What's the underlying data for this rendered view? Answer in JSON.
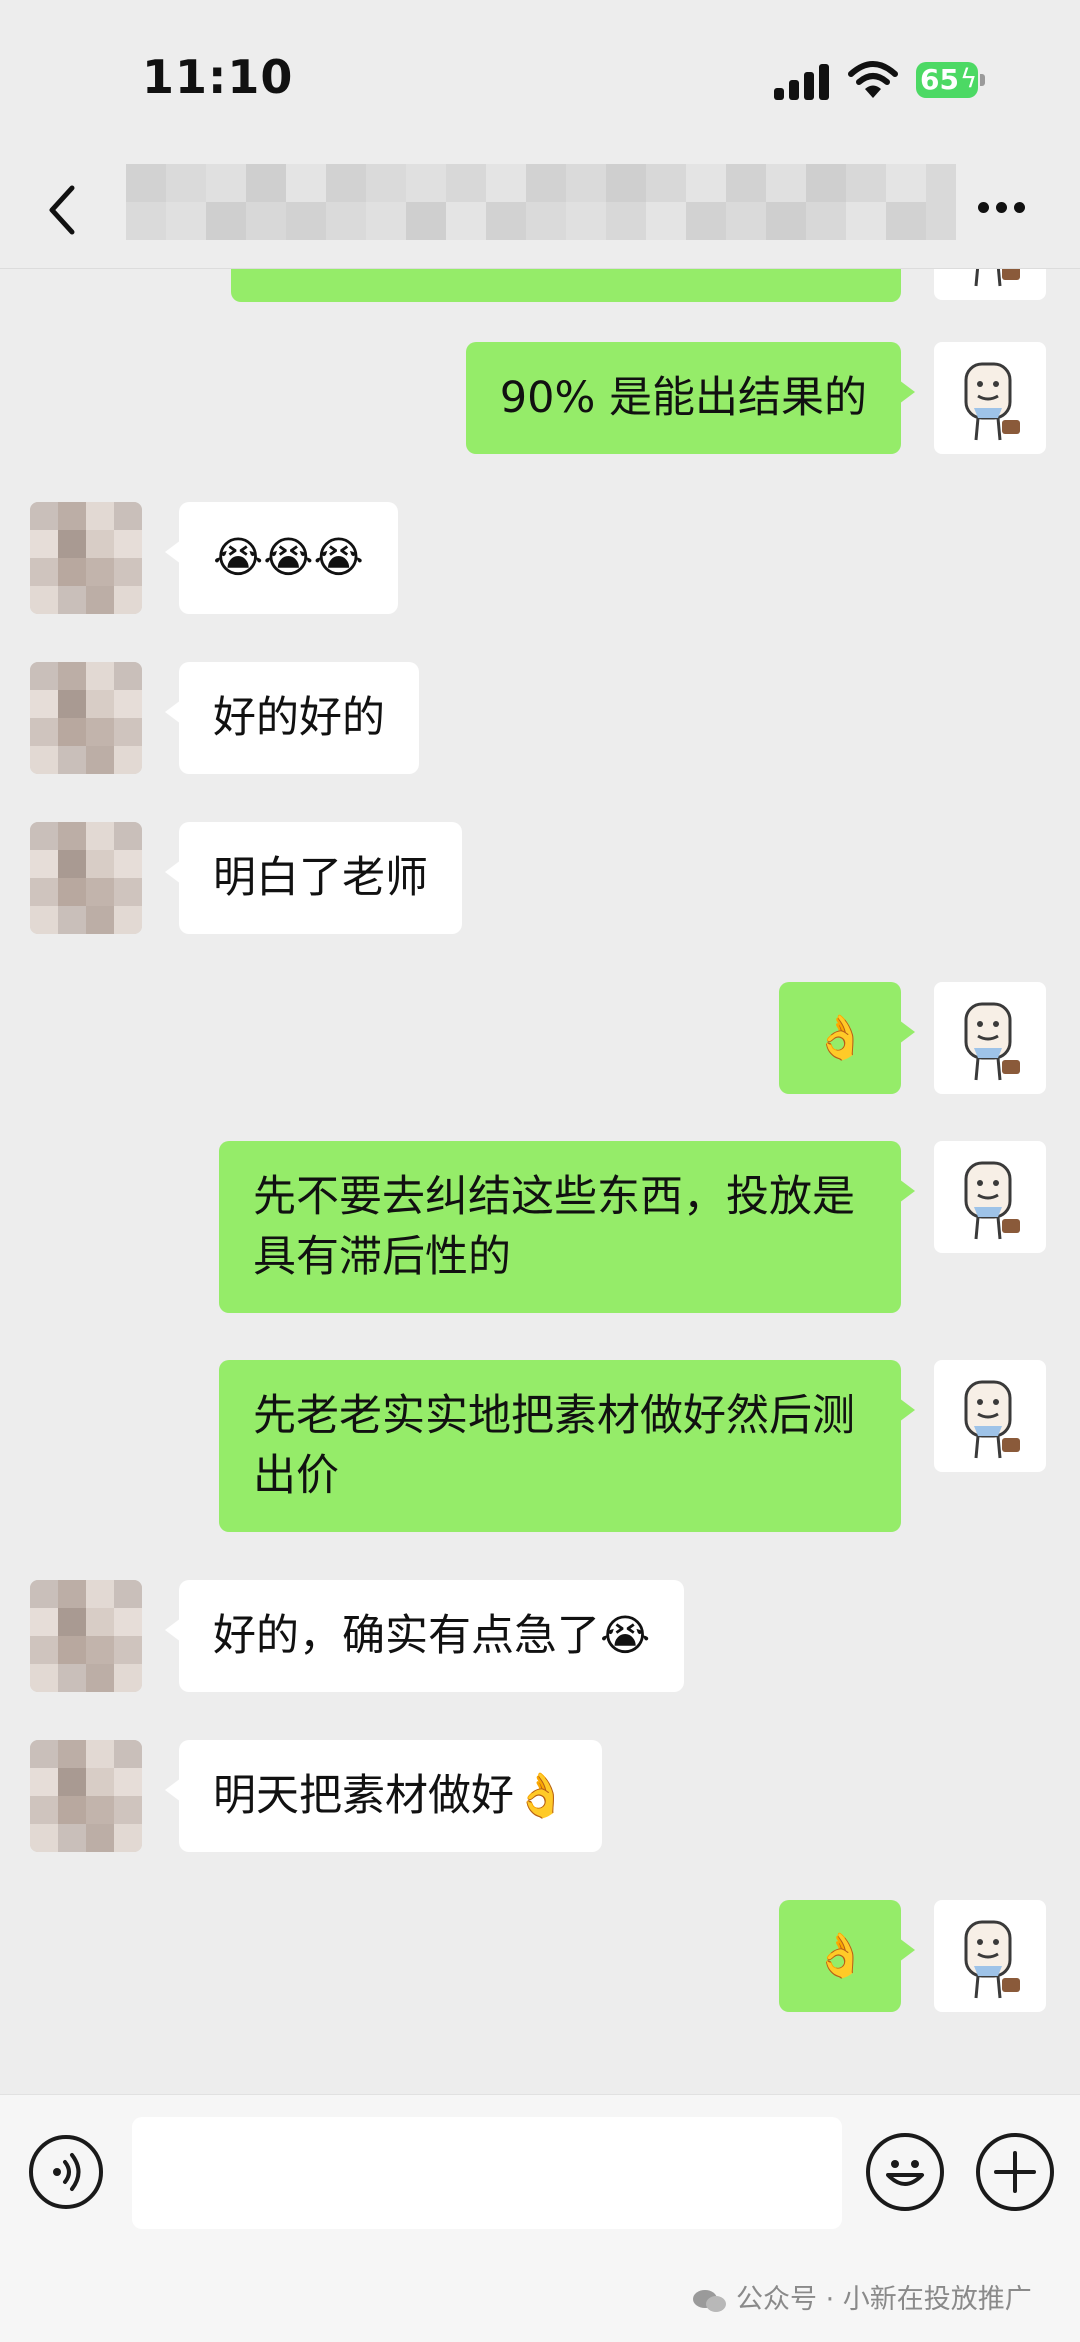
{
  "status_bar": {
    "time": "11:10",
    "battery_level": "65"
  },
  "nav": {
    "title": ""
  },
  "messages": [
    {
      "side": "self",
      "text": ""
    },
    {
      "side": "self",
      "text": "90% 是能出结果的"
    },
    {
      "side": "other",
      "text": "😭😭😭"
    },
    {
      "side": "other",
      "text": "好的好的"
    },
    {
      "side": "other",
      "text": "明白了老师"
    },
    {
      "side": "self",
      "text": "👌"
    },
    {
      "side": "self",
      "text": "先不要去纠结这些东西，投放是具有滞后性的"
    },
    {
      "side": "self",
      "text": "先老老实实地把素材做好然后测出价"
    },
    {
      "side": "other",
      "text": "好的，确实有点急了😭"
    },
    {
      "side": "other",
      "text": "明天把素材做好👌"
    },
    {
      "side": "self",
      "text": "👌"
    }
  ],
  "input": {
    "placeholder": ""
  },
  "watermark": {
    "text": "公众号 · 小新在投放推广"
  },
  "icons": {
    "back": "chevron-left-icon",
    "more": "more-horizontal-icon",
    "voice": "voice-icon",
    "emoji": "emoji-icon",
    "plus": "plus-icon"
  },
  "colors": {
    "background": "#ededed",
    "self_bubble": "#95ec69",
    "other_bubble": "#ffffff",
    "battery": "#4cd964"
  }
}
